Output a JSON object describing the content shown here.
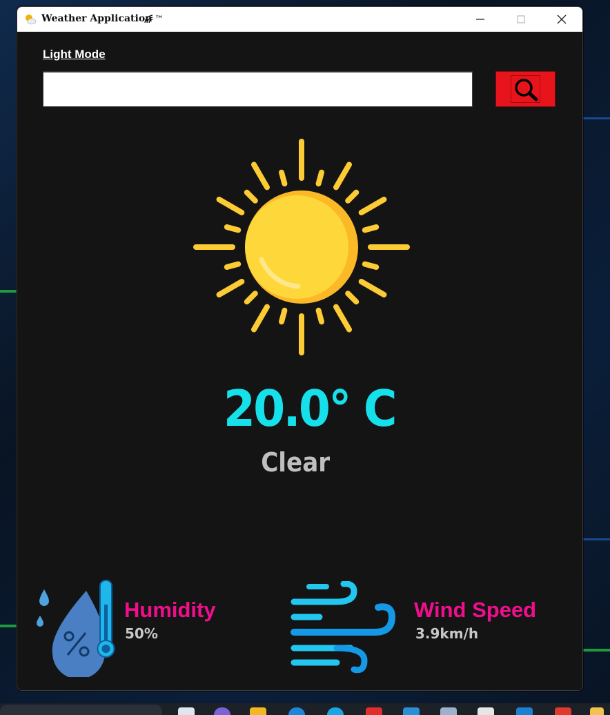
{
  "window": {
    "title": "Weather Application",
    "title_symbol": "™",
    "controls": {
      "minimize": "—",
      "maximize": "☐",
      "close": "✕"
    }
  },
  "theme_toggle": {
    "label": "Light Mode"
  },
  "search": {
    "value": "",
    "placeholder": "",
    "icon": "search-icon"
  },
  "weather": {
    "icon": "sun-icon",
    "temperature": "20.0° C",
    "condition": "Clear"
  },
  "humidity": {
    "label": "Humidity",
    "value": "50%",
    "icon": "humidity-icon"
  },
  "wind": {
    "label": "Wind Speed",
    "value": "3.9km/h",
    "icon": "wind-icon"
  },
  "colors": {
    "window_bg": "#141414",
    "accent_temp": "#16e0ea",
    "label_pink": "#f00e8c",
    "search_button": "#e8141b",
    "sun": "#fdd835"
  }
}
